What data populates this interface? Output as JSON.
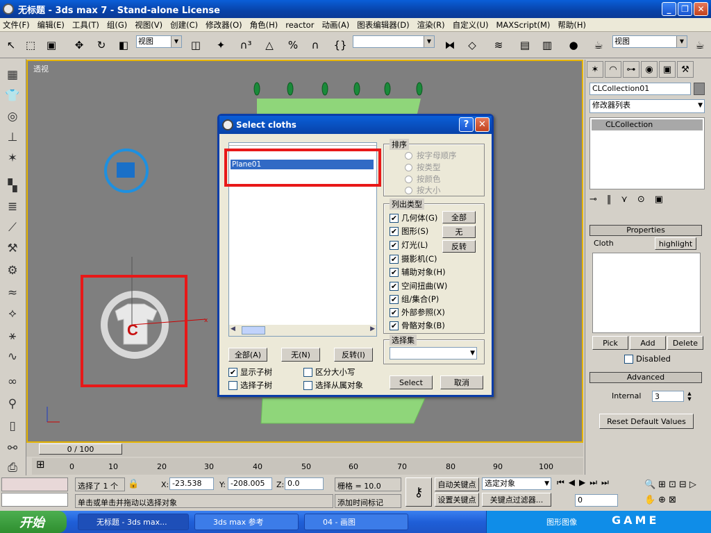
{
  "window": {
    "title": "无标题 - 3ds max 7 - Stand-alone License"
  },
  "menu": [
    "文件(F)",
    "编辑(E)",
    "工具(T)",
    "组(G)",
    "视图(V)",
    "创建(C)",
    "修改器(O)",
    "角色(H)",
    "reactor",
    "动画(A)",
    "图表编辑器(D)",
    "渲染(R)",
    "自定义(U)",
    "MAXScript(M)",
    "帮助(H)"
  ],
  "toolbar": {
    "view_select": "视图",
    "view_select2": "视图"
  },
  "viewport": {
    "label": "透视",
    "time_display": "0 / 100",
    "scene_letter": "C"
  },
  "timeline": {
    "ticks": [
      "0",
      "10",
      "20",
      "30",
      "40",
      "50",
      "60",
      "70",
      "80",
      "90",
      "100"
    ]
  },
  "command_panel": {
    "object_name": "CLCollection01",
    "modifier_list": "修改器列表",
    "stack_item": "CLCollection",
    "properties": {
      "title": "Properties",
      "cloth_label": "Cloth",
      "highlight_btn": "highlight",
      "pick": "Pick",
      "add": "Add",
      "delete": "Delete",
      "disabled": "Disabled"
    },
    "advanced": {
      "title": "Advanced",
      "internal_label": "Internal",
      "internal_value": "3",
      "reset": "Reset Default Values"
    }
  },
  "dialog": {
    "title": "Select cloths",
    "list_items": [
      "Plane01"
    ],
    "sort_title": "排序",
    "sort_options": [
      "按字母顺序",
      "按类型",
      "按颜色",
      "按大小"
    ],
    "list_types_title": "列出类型",
    "list_types": [
      "几何体(G)",
      "图形(S)",
      "灯光(L)",
      "摄影机(C)",
      "辅助对象(H)",
      "空间扭曲(W)",
      "组/集合(P)",
      "外部参照(X)",
      "骨骼对象(B)"
    ],
    "type_buttons": [
      "全部",
      "无",
      "反转"
    ],
    "selection_set_title": "选择集",
    "all_btn": "全部(A)",
    "none_btn": "无(N)",
    "invert_btn": "反转(I)",
    "show_subtree": "显示子树",
    "case_sensitive": "区分大小写",
    "select_subtree": "选择子树",
    "select_dependents": "选择从属对象",
    "select_btn": "Select",
    "cancel_btn": "取消"
  },
  "status": {
    "selected": "选择了 1 个",
    "x_label": "X:",
    "x_value": "-23.538",
    "y_label": "Y:",
    "y_value": "-208.005",
    "z_label": "Z:",
    "z_value": "0.0",
    "grid": "栅格 = 10.0",
    "auto_key": "自动关键点",
    "set_key": "设置关键点",
    "key_mode": "选定对象",
    "key_filter": "关键点过滤器...",
    "hint": "单击或单击并拖动以选择对象",
    "add_time_tag": "添加时间标记",
    "frame": "0"
  },
  "taskbar": {
    "start": "开始",
    "tasks": [
      "无标题 - 3ds max...",
      "3ds max 参考",
      "04 - 画图"
    ],
    "tray": "图形图像",
    "game": "GAME"
  }
}
